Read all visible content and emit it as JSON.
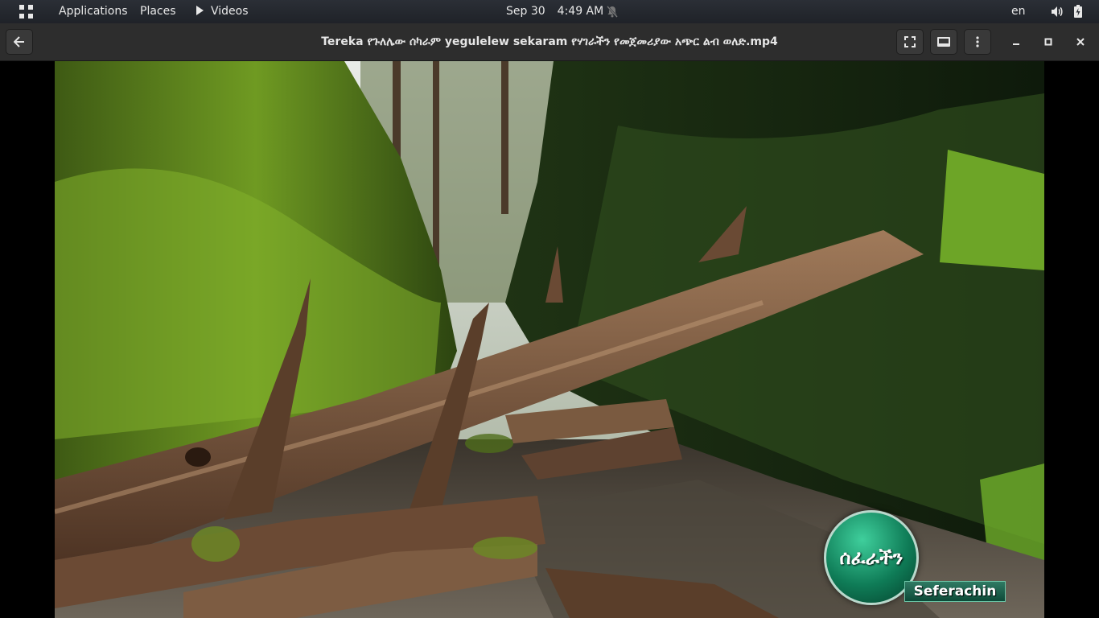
{
  "topbar": {
    "applications": "Applications",
    "places": "Places",
    "videos": "Videos",
    "date": "Sep 30",
    "time": "4:49 AM",
    "language": "en",
    "icons": [
      "apps-grid-icon",
      "play-icon",
      "notifications-disabled-icon",
      "volume-icon",
      "battery-icon"
    ]
  },
  "window": {
    "title": "Tereka የጉለሌው ሰካራም yegulelew sekaram የሃገራችን የመጀመሪያው አጭር ልብ ወለድ.mp4",
    "buttons": [
      "back-icon",
      "fullscreen-icon",
      "subtitles-icon",
      "menu-icon",
      "minimize-icon",
      "maximize-icon",
      "close-icon"
    ]
  },
  "video": {
    "logo_text": "ሰፈራችን",
    "channel_name": "Seferachin",
    "colors": {
      "logo_green": "#0f7c57",
      "banner_green": "#2f7a63"
    }
  }
}
